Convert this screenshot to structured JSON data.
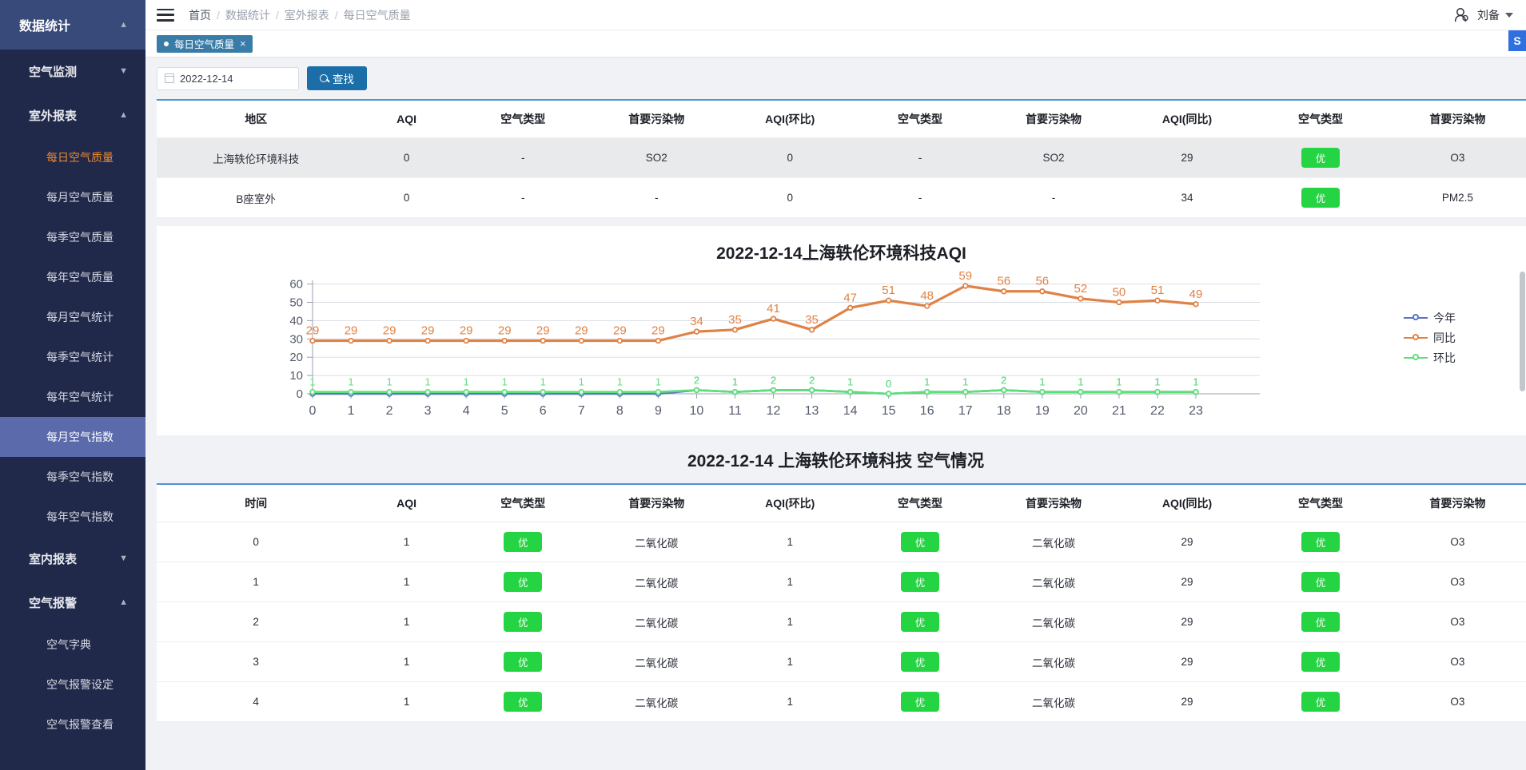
{
  "sidebar": {
    "root": {
      "label": "数据统计",
      "caret": "chevron-up"
    },
    "groups": [
      {
        "label": "空气监测",
        "caret": "chevron-down",
        "items": []
      },
      {
        "label": "室外报表",
        "caret": "chevron-up",
        "items": [
          {
            "label": "每日空气质量",
            "state": "active-orange"
          },
          {
            "label": "每月空气质量",
            "state": ""
          },
          {
            "label": "每季空气质量",
            "state": ""
          },
          {
            "label": "每年空气质量",
            "state": ""
          },
          {
            "label": "每月空气统计",
            "state": ""
          },
          {
            "label": "每季空气统计",
            "state": ""
          },
          {
            "label": "每年空气统计",
            "state": ""
          },
          {
            "label": "每月空气指数",
            "state": "active-blue"
          },
          {
            "label": "每季空气指数",
            "state": ""
          },
          {
            "label": "每年空气指数",
            "state": ""
          }
        ]
      },
      {
        "label": "室内报表",
        "caret": "chevron-down",
        "items": []
      },
      {
        "label": "空气报警",
        "caret": "chevron-up",
        "items": [
          {
            "label": "空气字典",
            "state": ""
          },
          {
            "label": "空气报警设定",
            "state": ""
          },
          {
            "label": "空气报警查看",
            "state": ""
          }
        ]
      }
    ]
  },
  "topbar": {
    "breadcrumb": [
      "首页",
      "数据统计",
      "室外报表",
      "每日空气质量"
    ],
    "separator": "/",
    "user": "刘备"
  },
  "tabs": [
    {
      "label": "每日空气质量",
      "close": "×"
    }
  ],
  "search": {
    "date_value": "2022-12-14",
    "button_label": "查找"
  },
  "summary_table": {
    "headers": [
      "地区",
      "AQI",
      "空气类型",
      "首要污染物",
      "AQI(环比)",
      "空气类型",
      "首要污染物",
      "AQI(同比)",
      "空气类型",
      "首要污染物"
    ],
    "rows": [
      [
        "上海轶伦环境科技",
        "0",
        "-",
        "SO2",
        "0",
        "-",
        "SO2",
        "29",
        "优",
        "O3"
      ],
      [
        "B座室外",
        "0",
        "-",
        "-",
        "0",
        "-",
        "-",
        "34",
        "优",
        "PM2.5"
      ]
    ]
  },
  "chart_data": {
    "type": "line",
    "title": "2022-12-14上海轶伦环境科技AQI",
    "xlabel": "",
    "ylabel": "",
    "ylim": [
      0,
      62
    ],
    "yticks": [
      0,
      10,
      20,
      30,
      40,
      50,
      60
    ],
    "grid": true,
    "legend_position": "right",
    "categories": [
      "0",
      "1",
      "2",
      "3",
      "4",
      "5",
      "6",
      "7",
      "8",
      "9",
      "10",
      "11",
      "12",
      "13",
      "14",
      "15",
      "16",
      "17",
      "18",
      "19",
      "20",
      "21",
      "22",
      "23"
    ],
    "series": [
      {
        "name": "今年",
        "color": "#5b74c4",
        "values": [
          0,
          0,
          0,
          0,
          0,
          0,
          0,
          0,
          0,
          0,
          2,
          1,
          2,
          2,
          1,
          0,
          1,
          1,
          2,
          1,
          1,
          1,
          1,
          1
        ],
        "labels": [
          "",
          "",
          "",
          "",
          "",
          "",
          "",
          "",
          "",
          "",
          "2",
          "1",
          "2",
          "2",
          "1",
          "0",
          "1",
          "1",
          "2",
          "1",
          "1",
          "1",
          "1",
          "1"
        ]
      },
      {
        "name": "同比",
        "color": "#e08245",
        "values": [
          29,
          29,
          29,
          29,
          29,
          29,
          29,
          29,
          29,
          29,
          34,
          35,
          41,
          35,
          47,
          51,
          48,
          59,
          56,
          56,
          52,
          50,
          51,
          49
        ],
        "labels": [
          "29",
          "29",
          "29",
          "29",
          "29",
          "29",
          "29",
          "29",
          "29",
          "29",
          "34",
          "35",
          "41",
          "35",
          "47",
          "51",
          "48",
          "59",
          "56",
          "56",
          "52",
          "50",
          "51",
          "49"
        ]
      },
      {
        "name": "环比",
        "color": "#5ce078",
        "values": [
          1,
          1,
          1,
          1,
          1,
          1,
          1,
          1,
          1,
          1,
          2,
          1,
          2,
          2,
          1,
          0,
          1,
          1,
          2,
          1,
          1,
          1,
          1,
          1
        ],
        "labels": [
          "1",
          "1",
          "1",
          "1",
          "1",
          "1",
          "1",
          "1",
          "1",
          "1",
          "2",
          "1",
          "2",
          "2",
          "1",
          "0",
          "1",
          "1",
          "2",
          "1",
          "1",
          "1",
          "1",
          "1"
        ]
      }
    ]
  },
  "detail_section_title": "2022-12-14 上海轶伦环境科技 空气情况",
  "detail_table": {
    "headers": [
      "时间",
      "AQI",
      "空气类型",
      "首要污染物",
      "AQI(环比)",
      "空气类型",
      "首要污染物",
      "AQI(同比)",
      "空气类型",
      "首要污染物"
    ],
    "rows": [
      [
        "0",
        "1",
        "优",
        "二氧化碳",
        "1",
        "优",
        "二氧化碳",
        "29",
        "优",
        "O3"
      ],
      [
        "1",
        "1",
        "优",
        "二氧化碳",
        "1",
        "优",
        "二氧化碳",
        "29",
        "优",
        "O3"
      ],
      [
        "2",
        "1",
        "优",
        "二氧化碳",
        "1",
        "优",
        "二氧化碳",
        "29",
        "优",
        "O3"
      ],
      [
        "3",
        "1",
        "优",
        "二氧化碳",
        "1",
        "优",
        "二氧化碳",
        "29",
        "优",
        "O3"
      ],
      [
        "4",
        "1",
        "优",
        "二氧化碳",
        "1",
        "优",
        "二氧化碳",
        "29",
        "优",
        "O3"
      ]
    ]
  },
  "side_badge": {
    "label": "S"
  },
  "colors": {
    "accent_blue": "#1b6ea8",
    "rule_blue": "#4b96d2",
    "good_green": "#25d443",
    "sidebar_bg": "#20294a",
    "sidebar_active": "#5a6aab",
    "sidebar_active_text": "#ef8a2b"
  }
}
